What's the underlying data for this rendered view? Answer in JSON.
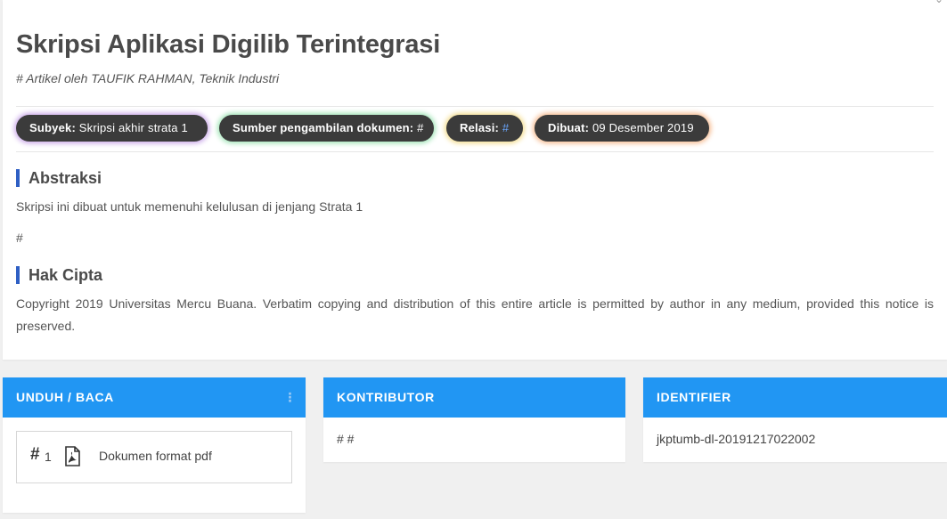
{
  "article": {
    "title": "Skripsi Aplikasi Digilib Terintegrasi",
    "byline": "# Artikel oleh TAUFIK RAHMAN, Teknik Industri"
  },
  "tags": {
    "subyek": {
      "label": "Subyek:",
      "value": "Skripsi akhir strata 1"
    },
    "sumber": {
      "label": "Sumber pengambilan dokumen:",
      "value": "#"
    },
    "relasi": {
      "label": "Relasi:",
      "value": "#"
    },
    "dibuat": {
      "label": "Dibuat:",
      "value": "09 Desember 2019"
    }
  },
  "abstraksi": {
    "heading": "Abstraksi",
    "text": "Skripsi ini dibuat untuk memenuhi kelulusan di jenjang Strata 1",
    "extra": "#"
  },
  "hak_cipta": {
    "heading": "Hak Cipta",
    "text": "Copyright 2019 Universitas Mercu Buana. Verbatim copying and distribution of this entire article is permitted by author in any medium, provided this notice is preserved."
  },
  "panels": {
    "unduh": {
      "title": "UNDUH / BACA",
      "menu_icon": "kebab-icon",
      "document": {
        "hash": "#",
        "number": "1",
        "icon": "pdf-file-icon",
        "label": "Dokumen format pdf"
      }
    },
    "kontributor": {
      "title": "KONTRIBUTOR",
      "text": "# #"
    },
    "identifier": {
      "title": "IDENTIFIER",
      "text": "jkptumb-dl-20191217022002"
    }
  },
  "colors": {
    "panel_header": "#2196f3",
    "tag_bg": "#3b3b3b",
    "section_accent": "#2e5fc4",
    "relasi_link": "#6aa7ff"
  }
}
